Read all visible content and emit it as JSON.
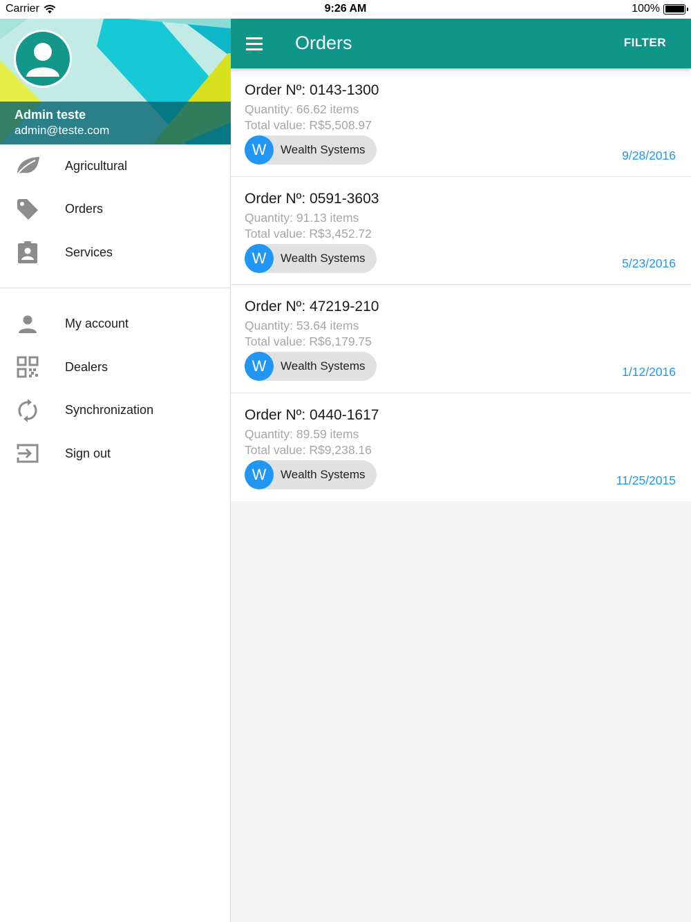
{
  "status_bar": {
    "carrier": "Carrier",
    "time": "9:26 AM",
    "battery": "100%",
    "battery_level": 1.0
  },
  "drawer": {
    "user": {
      "name": "Admin teste",
      "email": "admin@teste.com"
    },
    "primary_items": [
      {
        "label": "Agricultural",
        "icon": "leaf-icon"
      },
      {
        "label": "Orders",
        "icon": "tag-icon"
      },
      {
        "label": "Services",
        "icon": "clipboard-account-icon"
      }
    ],
    "secondary_items": [
      {
        "label": "My account",
        "icon": "person-icon"
      },
      {
        "label": "Dealers",
        "icon": "qr-code-icon"
      },
      {
        "label": "Synchronization",
        "icon": "sync-icon"
      },
      {
        "label": "Sign out",
        "icon": "sign-out-icon"
      }
    ]
  },
  "appbar": {
    "title": "Orders",
    "filter_label": "FILTER",
    "color": "#0f9688"
  },
  "orders": [
    {
      "number": "Order Nº: 0143-1300",
      "quantity": "Quantity: 66.62 items",
      "total": "Total value: R$5,508.97",
      "chip_initial": "W",
      "chip_label": "Wealth Systems",
      "date": "9/28/2016"
    },
    {
      "number": "Order Nº: 0591-3603",
      "quantity": "Quantity: 91.13 items",
      "total": "Total value: R$3,452.72",
      "chip_initial": "W",
      "chip_label": "Wealth Systems",
      "date": "5/23/2016"
    },
    {
      "number": "Order Nº: 47219-210",
      "quantity": "Quantity: 53.64 items",
      "total": "Total value: R$6,179.75",
      "chip_initial": "W",
      "chip_label": "Wealth Systems",
      "date": "1/12/2016"
    },
    {
      "number": "Order Nº: 0440-1617",
      "quantity": "Quantity: 89.59 items",
      "total": "Total value: R$9,238.16",
      "chip_initial": "W",
      "chip_label": "Wealth Systems",
      "date": "11/25/2015"
    }
  ],
  "colors": {
    "primary": "#0f9688",
    "accent": "#2196f3",
    "chip_bg": "#e1e1e1"
  }
}
